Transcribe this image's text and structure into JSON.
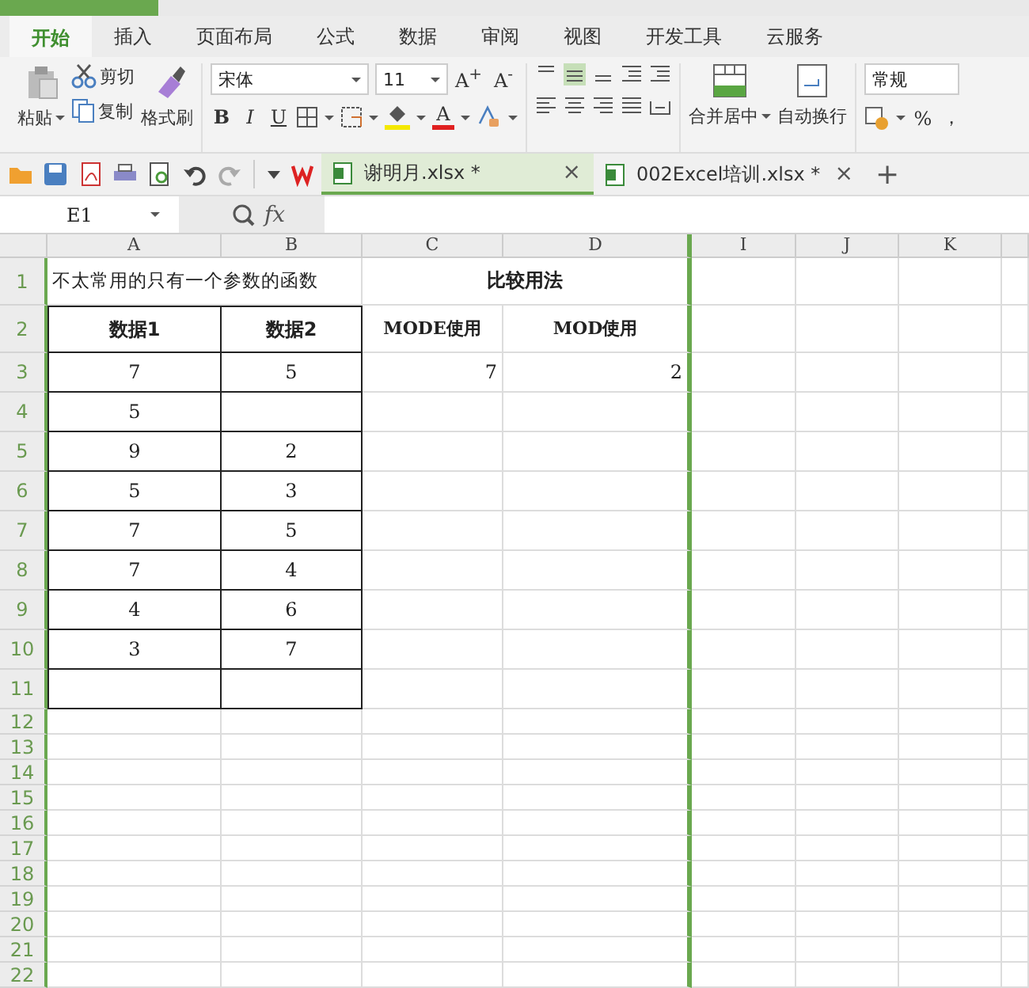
{
  "ribbon_tabs": [
    {
      "label": "开始",
      "selected": true
    },
    {
      "label": "插入",
      "selected": false
    },
    {
      "label": "页面布局",
      "selected": false
    },
    {
      "label": "公式",
      "selected": false
    },
    {
      "label": "数据",
      "selected": false
    },
    {
      "label": "审阅",
      "selected": false
    },
    {
      "label": "视图",
      "selected": false
    },
    {
      "label": "开发工具",
      "selected": false
    },
    {
      "label": "云服务",
      "selected": false
    }
  ],
  "ribbon": {
    "paste": "粘贴",
    "cut": "剪切",
    "copy": "复制",
    "format_painter": "格式刷",
    "font_name": "宋体",
    "font_size": "11",
    "font_grow": "A$^{+}$",
    "font_shrink": "A$^{-}$",
    "bold": "B",
    "italic": "I",
    "underline": "U",
    "font_color": "A",
    "merge": "合并居中",
    "wrap": "自动换行",
    "number_format": "常规",
    "percent": "%",
    "comma": "，"
  },
  "documents": [
    {
      "name": "谢明月.xlsx *",
      "selected": true,
      "close": "×"
    },
    {
      "name": "002Excel培训.xlsx *",
      "selected": false,
      "close": "×"
    }
  ],
  "new_tab": "+",
  "formula_bar": {
    "cell": "E1",
    "fx": "fx"
  },
  "sheet": {
    "columns": [
      "A",
      "B",
      "C",
      "D",
      "I",
      "J",
      "K"
    ],
    "rows": [
      {
        "number": "1",
        "kind": "title",
        "a": "不太常用的只有一个参数的函数",
        "c": "比较用法"
      },
      {
        "number": "2",
        "kind": "header",
        "a": "数据1",
        "b": "数据2",
        "c": "MODE使用",
        "d": "MOD使用"
      },
      {
        "number": "3",
        "kind": "data",
        "a": "7",
        "b": "5",
        "c": "7",
        "d": "2"
      },
      {
        "number": "4",
        "kind": "data",
        "a": "5"
      },
      {
        "number": "5",
        "kind": "data",
        "a": "9",
        "b": "2"
      },
      {
        "number": "6",
        "kind": "data",
        "a": "5",
        "b": "3"
      },
      {
        "number": "7",
        "kind": "data",
        "a": "7",
        "b": "5"
      },
      {
        "number": "8",
        "kind": "data",
        "a": "7",
        "b": "4"
      },
      {
        "number": "9",
        "kind": "data",
        "a": "4",
        "b": "6"
      },
      {
        "number": "10",
        "kind": "data",
        "a": "3",
        "b": "7"
      },
      {
        "number": "11",
        "kind": "data"
      },
      {
        "number": "12",
        "kind": "blank"
      },
      {
        "number": "13",
        "kind": "blank"
      },
      {
        "number": "14",
        "kind": "blank"
      },
      {
        "number": "15",
        "kind": "blank"
      },
      {
        "number": "16",
        "kind": "blank"
      },
      {
        "number": "17",
        "kind": "blank"
      },
      {
        "number": "18",
        "kind": "blank"
      },
      {
        "number": "19",
        "kind": "blank"
      },
      {
        "number": "20",
        "kind": "blank"
      },
      {
        "number": "21",
        "kind": "blank"
      },
      {
        "number": "22",
        "kind": "blank"
      }
    ]
  }
}
